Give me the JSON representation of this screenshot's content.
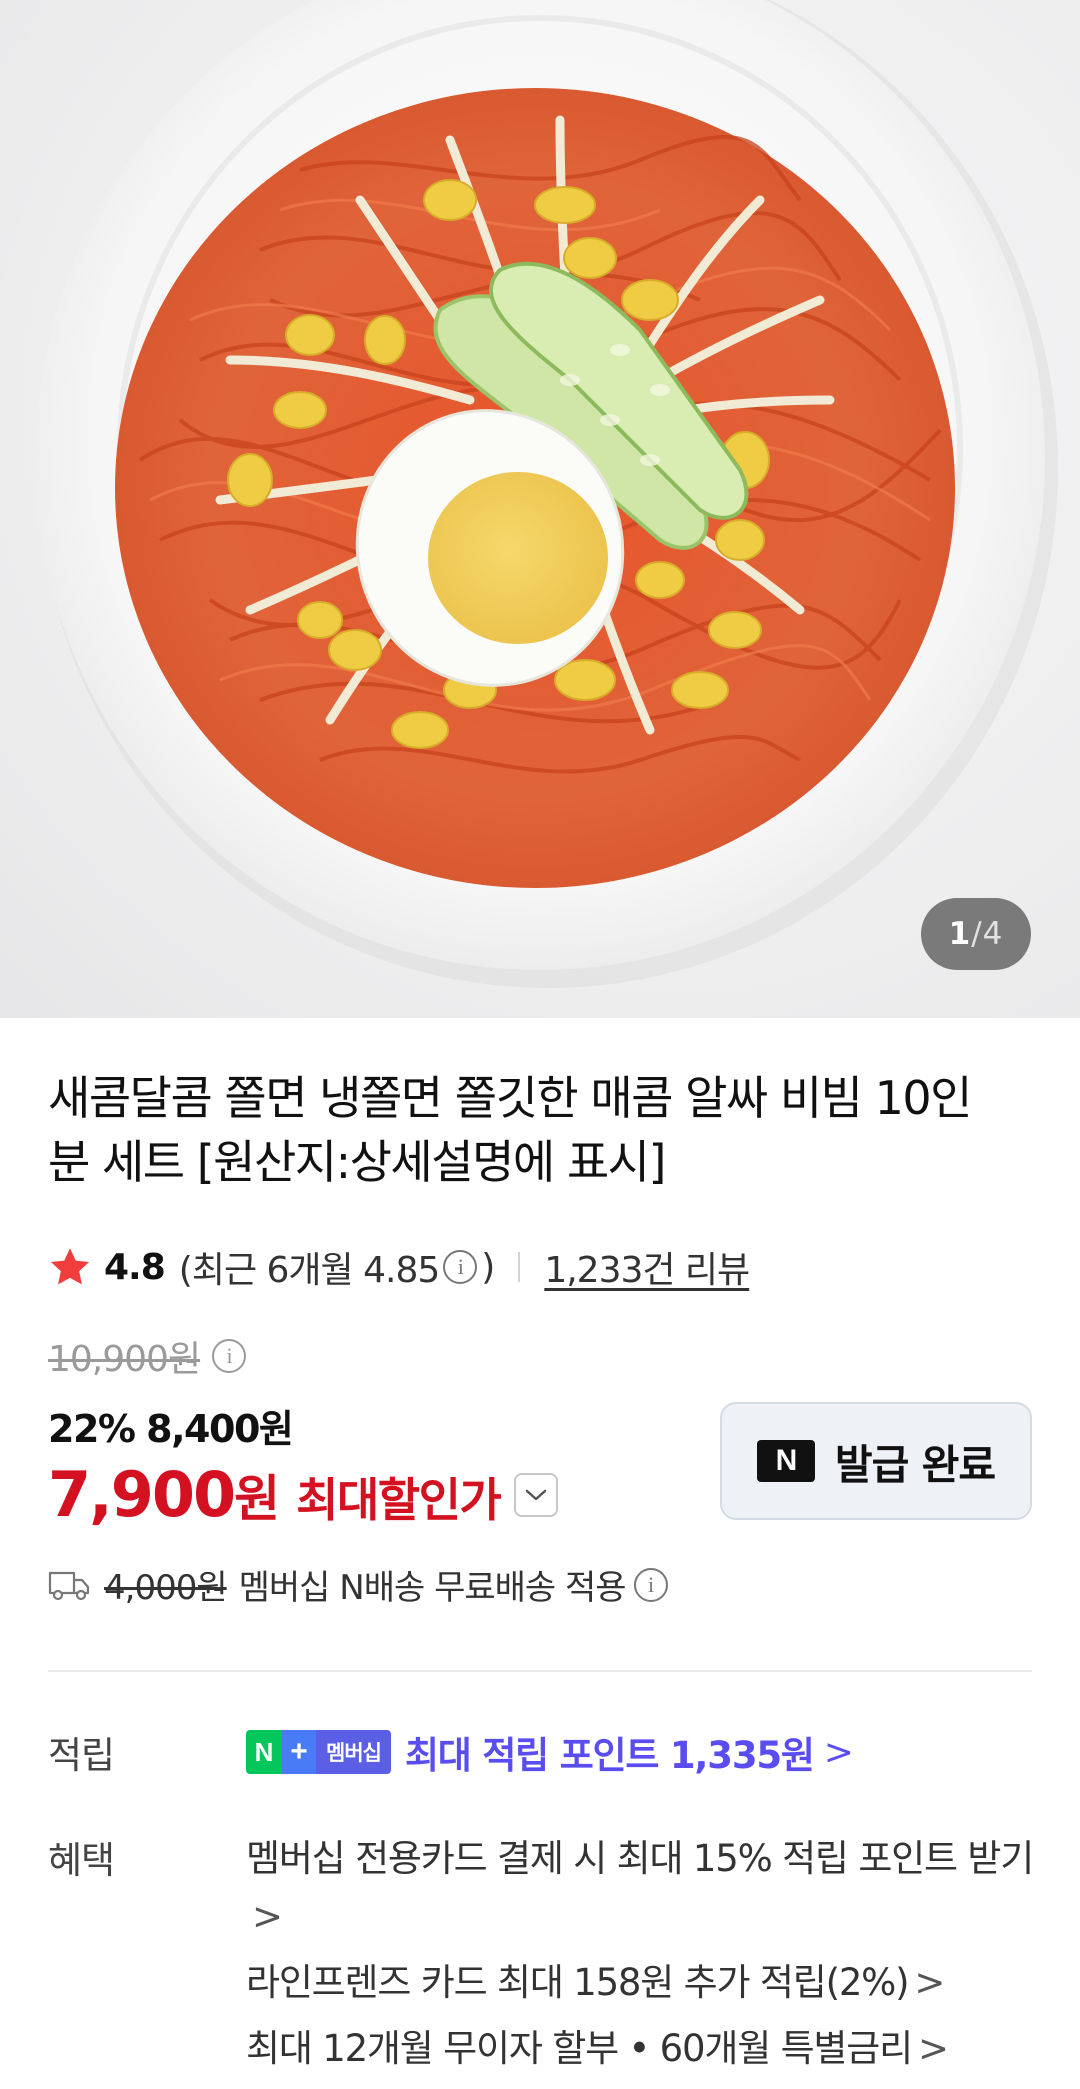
{
  "gallery": {
    "current": "1",
    "separator": "/",
    "total": "4"
  },
  "product": {
    "title": "새콤달콤 쫄면 냉쫄면 쫄깃한 매콤 알싸 비빔 10인분 세트 [원산지:상세설명에 표시]"
  },
  "rating": {
    "score": "4.8",
    "recent_prefix": "(최근 6개월 4.85",
    "recent_suffix": ")",
    "review_link": "1,233건 리뷰",
    "star_color": "#f23d3d"
  },
  "price": {
    "original": "10,900원",
    "discount_line": "22% 8,400원",
    "final_number": "7,900",
    "final_unit": "원",
    "final_label": "최대할인가",
    "accent_color": "#d31121"
  },
  "coupon": {
    "badge": "N",
    "label": "발급 완료"
  },
  "shipping": {
    "fee": "4,000원",
    "text": "멤버십 N배송 무료배송 적용"
  },
  "points": {
    "label": "적립",
    "badge_n": "N",
    "badge_plus": "+",
    "badge_text": "멤버십",
    "text": "최대 적립 포인트 1,335원",
    "arrow": ">"
  },
  "benefits": {
    "label": "혜택",
    "items": [
      "멤버십 전용카드 결제 시 최대 15% 적립 포인트 받기",
      "라인프렌즈 카드 최대 158원 추가 적립(2%)",
      "최대 12개월 무이자 할부 • 60개월 특별금리"
    ],
    "arrow": ">"
  }
}
